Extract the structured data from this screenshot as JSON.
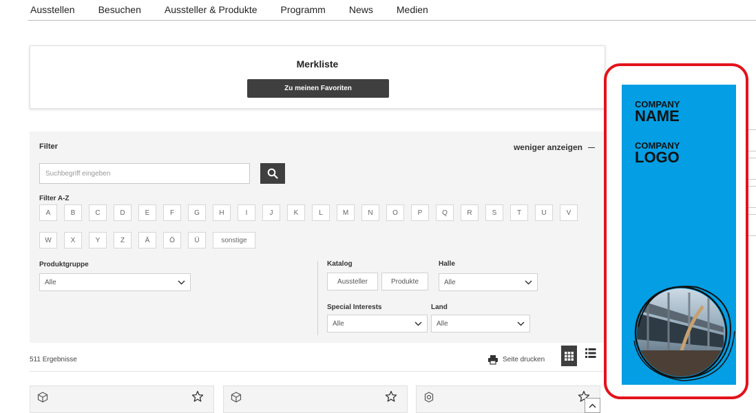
{
  "nav": {
    "items": [
      "Ausstellen",
      "Besuchen",
      "Aussteller & Produkte",
      "Programm",
      "News",
      "Medien"
    ]
  },
  "merkliste": {
    "title": "Merkliste",
    "button": "Zu meinen Favoriten"
  },
  "filter": {
    "title": "Filter",
    "less_label": "weniger anzeigen",
    "search_placeholder": "Suchbegriff eingeben",
    "az_label": "Filter A-Z",
    "az_row1": [
      "A",
      "B",
      "C",
      "D",
      "E",
      "F",
      "G",
      "H",
      "I",
      "J",
      "K",
      "L",
      "M",
      "N",
      "O",
      "P",
      "Q",
      "R",
      "S",
      "T",
      "U",
      "V"
    ],
    "az_row2": [
      "W",
      "X",
      "Y",
      "Z",
      "Ä",
      "Ö",
      "Ü",
      "sonstige"
    ],
    "produktgruppe": {
      "label": "Produktgruppe",
      "value": "Alle"
    },
    "katalog": {
      "label": "Katalog",
      "options": [
        "Aussteller",
        "Produkte"
      ]
    },
    "halle": {
      "label": "Halle",
      "value": "Alle"
    },
    "special": {
      "label": "Special Interests",
      "value": "Alle"
    },
    "land": {
      "label": "Land",
      "value": "Alle"
    }
  },
  "results": {
    "count_text": "511 Ergebnisse",
    "print_label": "Seite drucken"
  },
  "ad": {
    "line1_small": "COMPANY",
    "line1_big": "NAME",
    "line2_small": "COMPANY",
    "line2_big": "LOGO",
    "background": "#039ee3",
    "frame_color": "#e3131b"
  }
}
